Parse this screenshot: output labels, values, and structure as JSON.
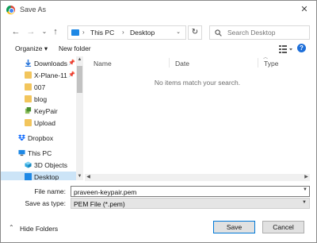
{
  "window": {
    "title": "Save As",
    "close_glyph": "✕",
    "app_icon": "chrome-icon"
  },
  "nav": {
    "back_glyph": "←",
    "forward_glyph": "→",
    "recent_glyph": "⌄",
    "up_glyph": "↑",
    "breadcrumb": [
      "This PC",
      "Desktop"
    ],
    "breadcrumb_sep": "›",
    "address_dropdown_glyph": "⌄",
    "refresh_glyph": "↻",
    "search_placeholder": "Search Desktop"
  },
  "toolbar": {
    "organize_label": "Organize ▾",
    "new_folder_label": "New folder",
    "help_glyph": "?"
  },
  "sidebar": {
    "items": [
      {
        "label": "Downloads",
        "icon": "download-icon",
        "pinned": true
      },
      {
        "label": "X-Plane-11",
        "icon": "folder-icon",
        "pinned": true
      },
      {
        "label": "007",
        "icon": "folder-icon",
        "pinned": false
      },
      {
        "label": "blog",
        "icon": "folder-icon",
        "pinned": false
      },
      {
        "label": "KeyPair",
        "icon": "keypair-icon",
        "pinned": false
      },
      {
        "label": "Upload",
        "icon": "folder-icon",
        "pinned": false
      },
      {
        "label": "Dropbox",
        "icon": "dropbox-icon",
        "pinned": false
      },
      {
        "label": "This PC",
        "icon": "computer-icon",
        "pinned": false
      },
      {
        "label": "3D Objects",
        "icon": "cube-icon",
        "pinned": false
      },
      {
        "label": "Desktop",
        "icon": "desktop-icon",
        "pinned": false,
        "selected": true
      }
    ]
  },
  "filelist": {
    "columns": [
      "Name",
      "Date",
      "Type"
    ],
    "empty_message": "No items match your search."
  },
  "form": {
    "filename_label": "File name:",
    "filename_value": "praveen-keypair.pem",
    "filetype_label": "Save as type:",
    "filetype_value": "PEM File (*.pem)"
  },
  "footer": {
    "hide_folders_label": "Hide Folders",
    "save_label": "Save",
    "cancel_label": "Cancel"
  },
  "colors": {
    "accent": "#0078d7",
    "selection": "#cce4f7",
    "folder": "#f2c55c"
  }
}
